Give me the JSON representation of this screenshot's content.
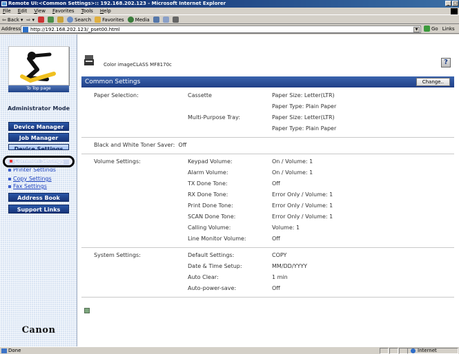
{
  "window": {
    "title": "Remote UI:<Common Settings>:: 192.168.202.123 - Microsoft Internet Explorer"
  },
  "menu": [
    "File",
    "Edit",
    "View",
    "Favorites",
    "Tools",
    "Help"
  ],
  "toolbar": {
    "back": "Back",
    "search": "Search",
    "favorites": "Favorites",
    "media": "Media"
  },
  "address": {
    "label": "Address",
    "url": "http://192.168.202.123/_pset00.html",
    "go": "Go",
    "links": "Links"
  },
  "sidebar": {
    "top_page": "To Top page",
    "admin_mode": "Administrator Mode",
    "device_manager": "Device Manager",
    "job_manager": "Job Manager",
    "device_settings": "Device Settings",
    "common_settings": "Common Settings",
    "printer_settings": "Printer Settings",
    "copy_settings": "Copy Settings",
    "fax_settings": "Fax Settings",
    "address_book": "Address Book",
    "support_links": "Support Links",
    "brand": "Canon"
  },
  "main": {
    "device_name": "Color imageCLASS MF8170c",
    "section_title": "Common Settings",
    "change_button": "Change..",
    "help": "?",
    "paper": {
      "label": "Paper Selection:",
      "cassette": "Cassette",
      "cassette_size": "Paper Size: Letter(LTR)",
      "cassette_type": "Paper Type: Plain Paper",
      "tray": "Multi-Purpose Tray:",
      "tray_size": "Paper Size: Letter(LTR)",
      "tray_type": "Paper Type: Plain Paper"
    },
    "bw_toner": {
      "label": "Black and White Toner Saver:",
      "value": "Off"
    },
    "volume": {
      "label": "Volume Settings:",
      "items": [
        {
          "name": "Keypad Volume:",
          "value": "On / Volume: 1"
        },
        {
          "name": "Alarm Volume:",
          "value": "On / Volume: 1"
        },
        {
          "name": "TX Done Tone:",
          "value": "Off"
        },
        {
          "name": "RX Done Tone:",
          "value": "Error Only / Volume: 1"
        },
        {
          "name": "Print Done Tone:",
          "value": "Error Only / Volume: 1"
        },
        {
          "name": "SCAN Done Tone:",
          "value": "Error Only / Volume: 1"
        },
        {
          "name": "Calling Volume:",
          "value": "Volume: 1"
        },
        {
          "name": "Line Monitor Volume:",
          "value": "Off"
        }
      ]
    },
    "system": {
      "label": "System Settings:",
      "items": [
        {
          "name": "Default Settings:",
          "value": "COPY"
        },
        {
          "name": "Date & Time Setup:",
          "value": "MM/DD/YYYY"
        },
        {
          "name": "Auto Clear:",
          "value": " 1 min"
        },
        {
          "name": "Auto-power-save:",
          "value": "Off"
        }
      ]
    }
  },
  "status": {
    "text": "Done",
    "zone": "Internet"
  }
}
